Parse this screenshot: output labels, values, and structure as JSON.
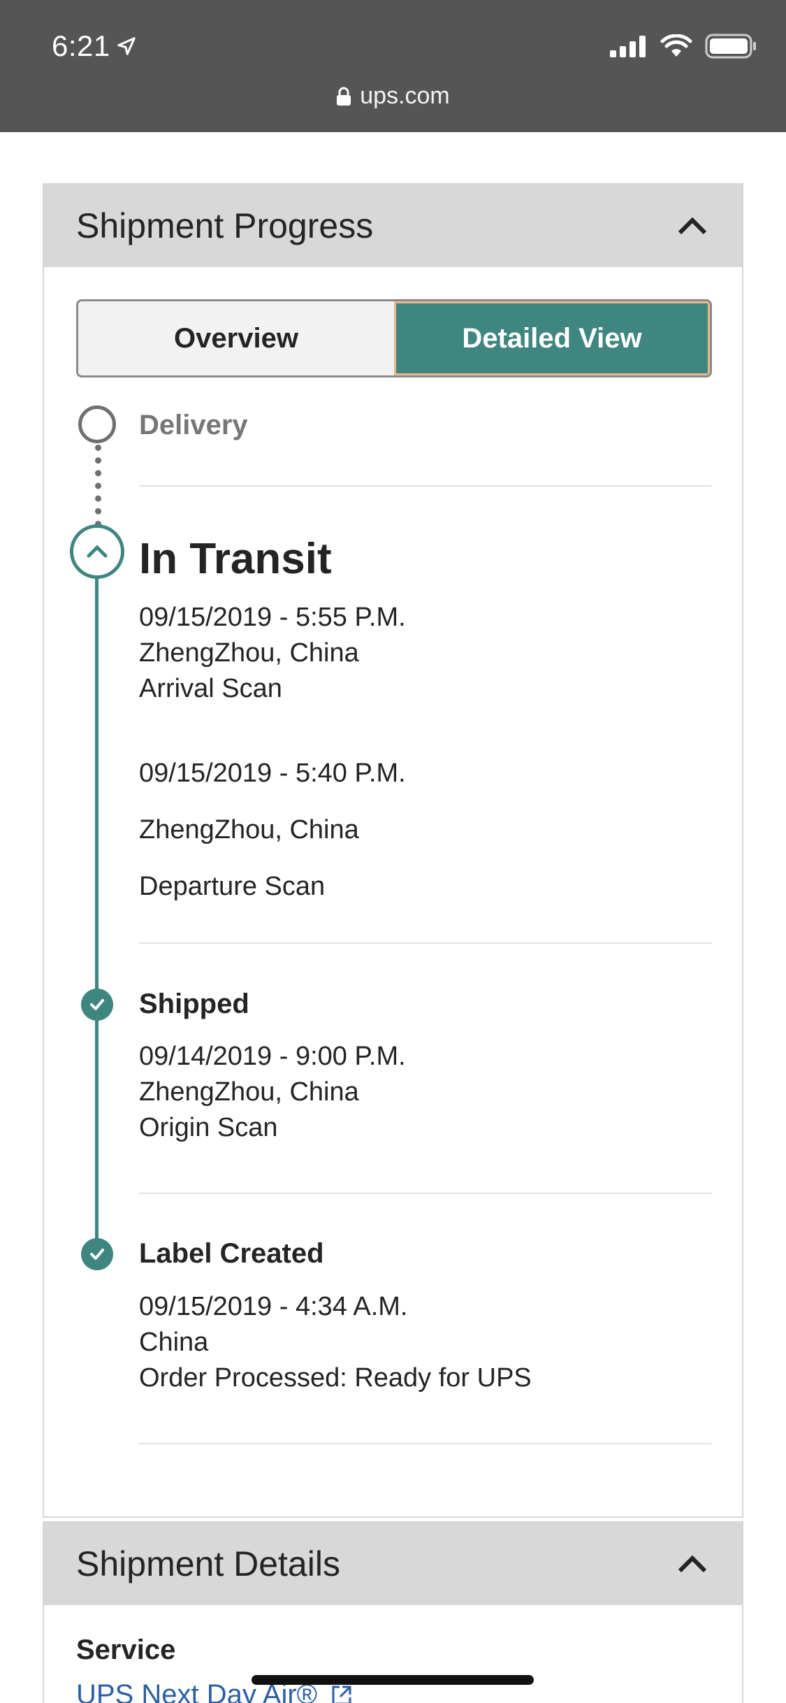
{
  "status_bar": {
    "time": "6:21",
    "url": "ups.com"
  },
  "colors": {
    "accent": "#3f8580",
    "header_bg": "#d8d8d8",
    "topbar": "#555555",
    "link": "#2b5fa5"
  },
  "shipment_progress": {
    "title": "Shipment Progress",
    "toggle": {
      "overview": "Overview",
      "detailed": "Detailed View",
      "selected": "Detailed View"
    },
    "delivery_label": "Delivery",
    "in_transit": {
      "title": "In Transit",
      "events": [
        {
          "datetime": "09/15/2019 - 5:55 P.M.",
          "location": "ZhengZhou, China",
          "activity": "Arrival Scan"
        },
        {
          "datetime": "09/15/2019 - 5:40 P.M.",
          "location": "ZhengZhou, China",
          "activity": "Departure Scan"
        }
      ]
    },
    "shipped": {
      "title": "Shipped",
      "datetime": "09/14/2019 - 9:00 P.M.",
      "location": "ZhengZhou, China",
      "activity": "Origin Scan"
    },
    "label_created": {
      "title": "Label Created",
      "datetime": "09/15/2019 - 4:34 A.M.",
      "location": "China",
      "activity": "Order Processed: Ready for UPS"
    }
  },
  "shipment_details": {
    "title": "Shipment Details",
    "service_label": "Service",
    "service_value": "UPS Next Day Air®"
  }
}
